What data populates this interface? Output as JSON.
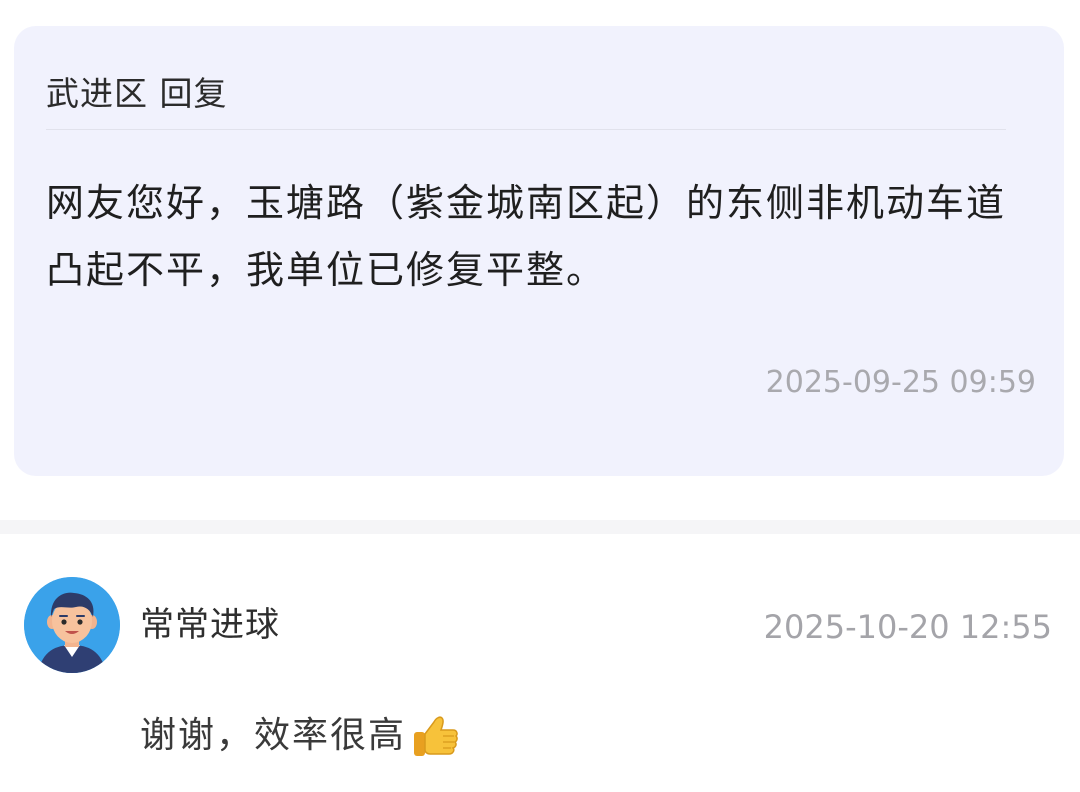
{
  "reply": {
    "header": "武进区 回复",
    "body": "网友您好，玉塘路（紫金城南区起）的东侧非机动车道凸起不平，我单位已修复平整。",
    "time": "2025-09-25 09:59",
    "background": "#f1f2fd"
  },
  "comment": {
    "user": "常常进球",
    "time": "2025-10-20 12:55",
    "text": "谢谢，效率很高",
    "avatar_icon": "cartoon-man-avatar-icon",
    "emoji_icon": "thumbs-up-icon"
  },
  "colors": {
    "avatar_bg": "#3aa2ea",
    "time_text": "#a9a9ae"
  }
}
